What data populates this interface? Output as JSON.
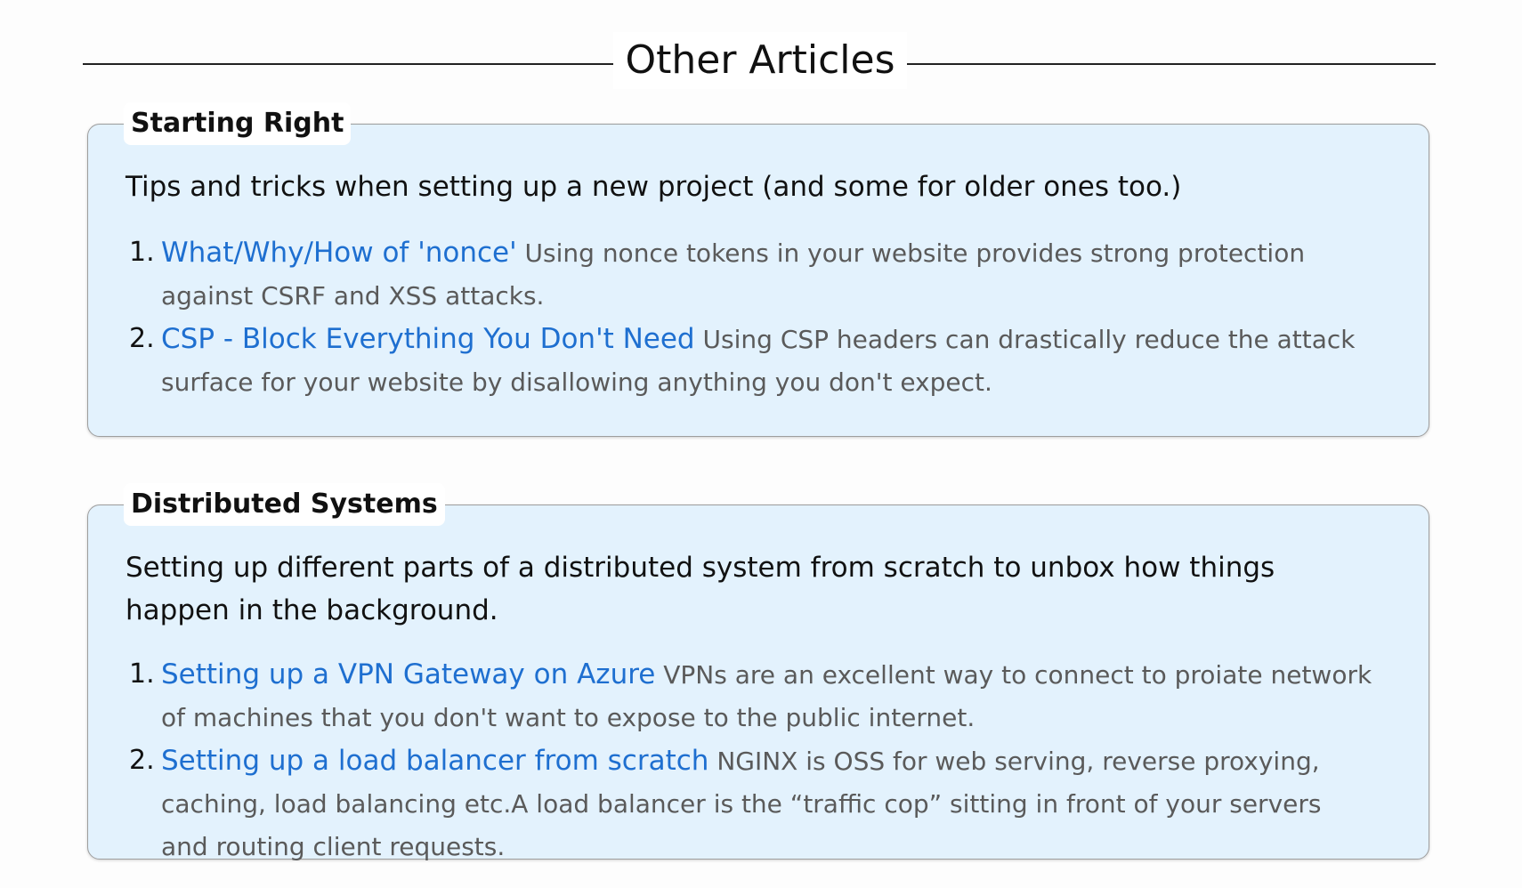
{
  "page_title": "Other Articles",
  "colors": {
    "section_background": "#e3f2fd",
    "link": "#1e6fd0",
    "summary_text": "#5a5a5a"
  },
  "sections": [
    {
      "title": "Starting Right",
      "description": "Tips and tricks when setting up a new project (and some for older ones too.)",
      "articles": [
        {
          "number": "1.",
          "title": "What/Why/How of 'nonce'",
          "summary": "Using nonce tokens in your website provides strong protection against CSRF and XSS attacks."
        },
        {
          "number": "2.",
          "title": "CSP - Block Everything You Don't Need",
          "summary": "Using CSP headers can drastically reduce the attack surface for your website by disallowing anything you don't expect."
        }
      ]
    },
    {
      "title": "Distributed Systems",
      "description": "Setting up different parts of a distributed system from scratch to unbox how things happen in the background.",
      "articles": [
        {
          "number": "1.",
          "title": "Setting up a VPN Gateway on Azure",
          "summary": "VPNs are an excellent way to connect to proiate network of machines that you don't want to expose to the public internet."
        },
        {
          "number": "2.",
          "title": "Setting up a load balancer from scratch",
          "summary": "NGINX is OSS for web serving, reverse proxying, caching, load balancing etc.A load balancer is the “traffic cop” sitting in front of your servers and routing client requests."
        }
      ]
    }
  ]
}
